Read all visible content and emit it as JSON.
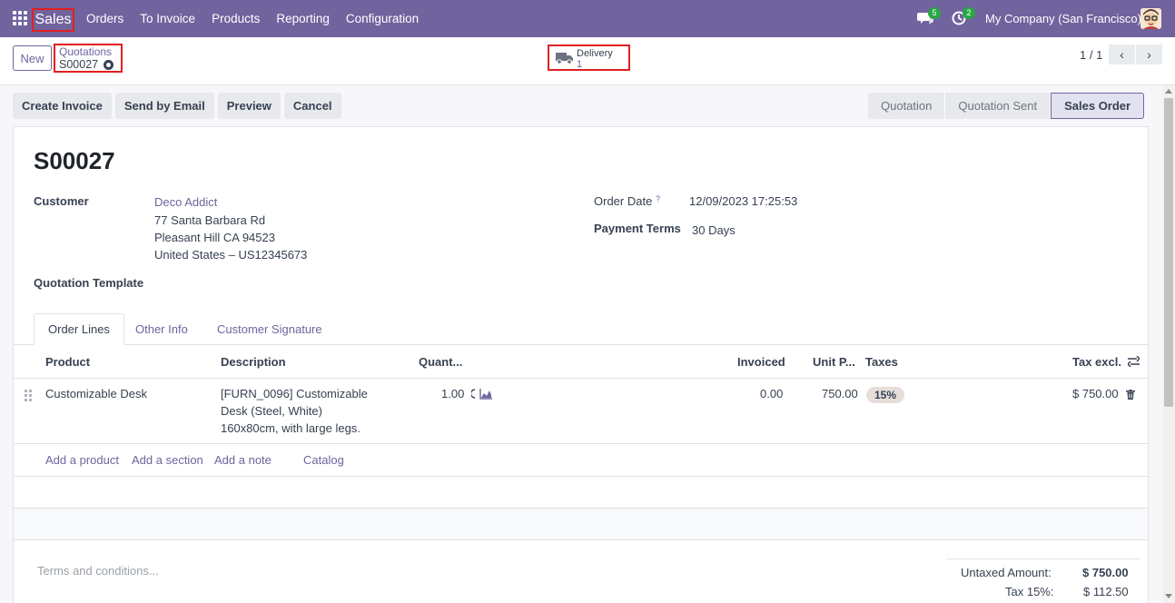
{
  "navbar": {
    "app_name": "Sales",
    "menu": [
      "Orders",
      "To Invoice",
      "Products",
      "Reporting",
      "Configuration"
    ],
    "messages_badge": "5",
    "activities_badge": "2",
    "company": "My Company (San Francisco)"
  },
  "control": {
    "new_label": "New",
    "breadcrumb_parent": "Quotations",
    "breadcrumb_current": "S00027",
    "delivery_label": "Delivery",
    "delivery_count": "1",
    "pager": "1 / 1"
  },
  "actions": [
    "Create Invoice",
    "Send by Email",
    "Preview",
    "Cancel"
  ],
  "statusbar": [
    "Quotation",
    "Quotation Sent",
    "Sales Order"
  ],
  "form": {
    "name": "S00027",
    "customer_label": "Customer",
    "customer_name": "Deco Addict",
    "customer_address": [
      "77 Santa Barbara Rd",
      "Pleasant Hill CA 94523",
      "United States – US12345673"
    ],
    "template_label": "Quotation Template",
    "order_date_label": "Order Date",
    "order_date_help": "?",
    "order_date": "12/09/2023 17:25:53",
    "payment_terms_label": "Payment Terms",
    "payment_terms": "30 Days"
  },
  "tabs": [
    "Order Lines",
    "Other Info",
    "Customer Signature"
  ],
  "table": {
    "headers": {
      "product": "Product",
      "description": "Description",
      "quantity": "Quant...",
      "invoiced": "Invoiced",
      "unit_price": "Unit P...",
      "taxes": "Taxes",
      "tax_excl": "Tax excl."
    },
    "rows": [
      {
        "product": "Customizable Desk",
        "description": [
          "[FURN_0096] Customizable",
          "Desk (Steel, White)",
          "160x80cm, with large legs."
        ],
        "quantity": "1.00",
        "invoiced": "0.00",
        "unit_price": "750.00",
        "tax": "15%",
        "subtotal": "$ 750.00"
      }
    ],
    "add_links": [
      "Add a product",
      "Add a section",
      "Add a note",
      "Catalog"
    ]
  },
  "terms_placeholder": "Terms and conditions...",
  "totals": {
    "untaxed_label": "Untaxed Amount:",
    "untaxed_value": "$ 750.00",
    "tax_label": "Tax 15%:",
    "tax_value": "$ 112.50"
  },
  "colors": {
    "brand": "#71639e",
    "highlight": "#e02020",
    "badge": "#28a745"
  }
}
